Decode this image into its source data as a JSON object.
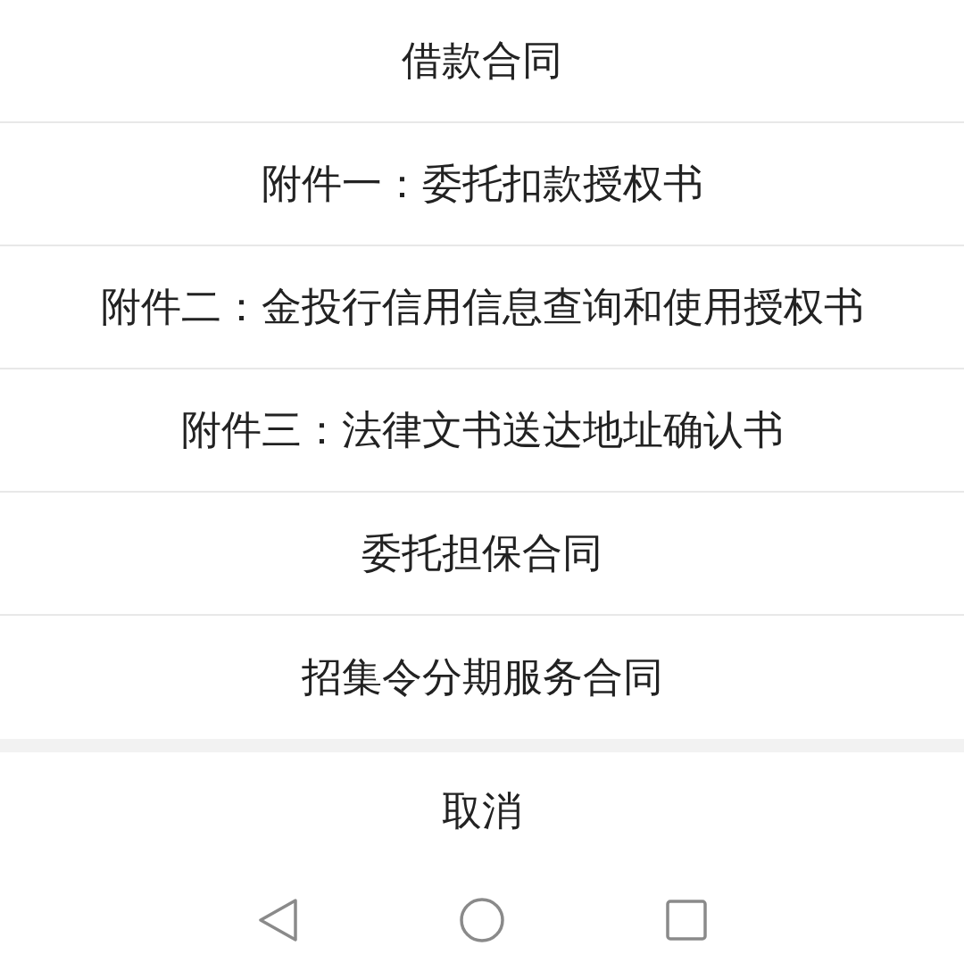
{
  "sheet": {
    "items": [
      {
        "label": "借款合同"
      },
      {
        "label": "附件一：委托扣款授权书"
      },
      {
        "label": "附件二：金投行信用信息查询和使用授权书"
      },
      {
        "label": "附件三：法律文书送达地址确认书"
      },
      {
        "label": "委托担保合同"
      },
      {
        "label": "招集令分期服务合同"
      }
    ],
    "cancel": "取消"
  }
}
